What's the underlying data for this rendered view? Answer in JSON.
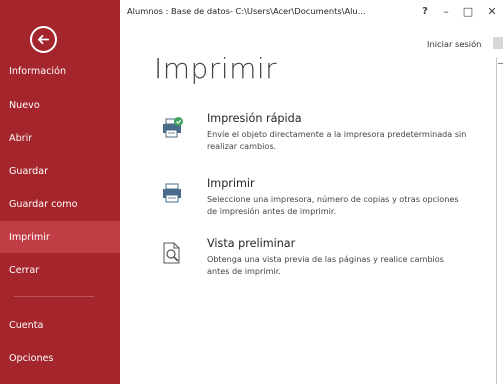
{
  "window": {
    "title": "Alumnos : Base de datos- C:\\Users\\Acer\\Documents\\Alu...",
    "help_label": "?",
    "minimize_label": "–",
    "restore_label": "□",
    "close_label": "✕",
    "signin_label": "Iniciar sesión"
  },
  "sidebar": {
    "items": [
      {
        "label": "Información"
      },
      {
        "label": "Nuevo"
      },
      {
        "label": "Abrir"
      },
      {
        "label": "Guardar"
      },
      {
        "label": "Guardar como"
      },
      {
        "label": "Imprimir",
        "active": true
      },
      {
        "label": "Cerrar"
      },
      {
        "label": "Cuenta"
      },
      {
        "label": "Opciones"
      }
    ]
  },
  "main": {
    "title": "Imprimir",
    "options": [
      {
        "title": "Impresión rápida",
        "description": "Envíe el objeto directamente a la impresora predeterminada sin realizar cambios.",
        "icon": "quick-print-icon"
      },
      {
        "title": "Imprimir",
        "description": "Seleccione una impresora, número de copias y otras opciones de impresión antes de imprimir.",
        "icon": "printer-icon"
      },
      {
        "title": "Vista preliminar",
        "description": "Obtenga una vista previa de las páginas y realice cambios antes de imprimir.",
        "icon": "print-preview-icon"
      }
    ]
  },
  "colors": {
    "sidebar_bg": "#a4262c",
    "sidebar_active": "#c13d46",
    "accent_green": "#3fa35b",
    "printer_blue": "#4a6b8a"
  }
}
